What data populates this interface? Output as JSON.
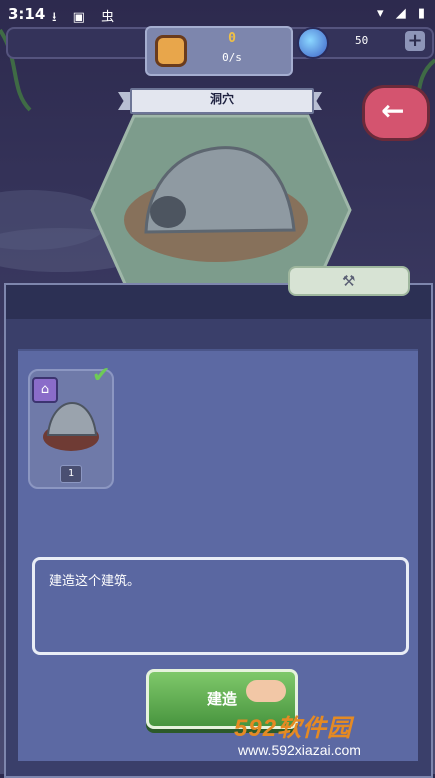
{
  "status_bar": {
    "time": "3:14",
    "left_icons": "⭳ ▣ 虫",
    "right_icons": "▾ ◢ ▮"
  },
  "resources": {
    "coin_value": "0",
    "coin_rate": "0/s",
    "gem_value": "50",
    "plus_label": "+"
  },
  "building": {
    "title": "洞穴",
    "level": "1",
    "description": "建造这个建筑。"
  },
  "actions": {
    "build_label": "建造",
    "back_label": "←"
  },
  "icons": {
    "coin": "coin-chest-icon",
    "gem": "gem-icon",
    "home": "home-icon",
    "check": "check-icon",
    "hammer": "hammer-icon",
    "hand": "pointing-hand-icon"
  },
  "watermark": {
    "brand": "592软件园",
    "url": "www.592xiazai.com"
  },
  "colors": {
    "accent_green": "#6ecb55",
    "back_red": "#d4546f",
    "panel": "#3a3f6a",
    "coin_gold": "#f0c045",
    "brand_orange": "#e58a23"
  }
}
